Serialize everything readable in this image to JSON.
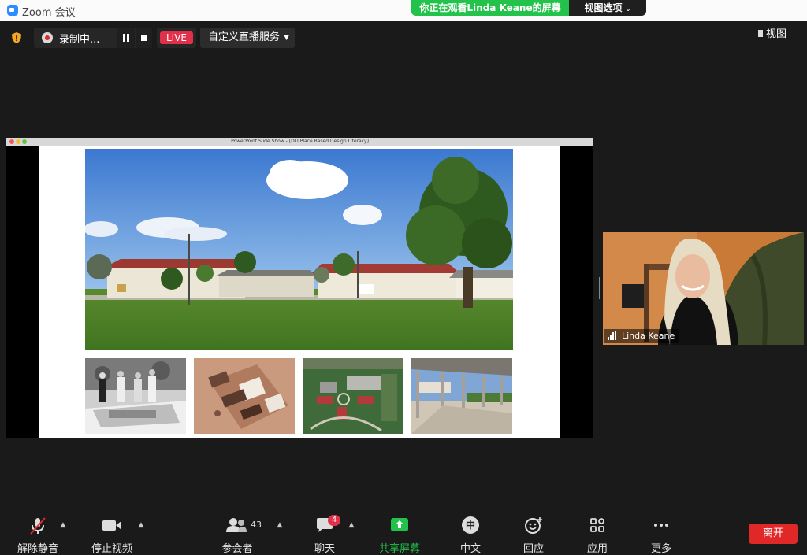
{
  "window": {
    "title": "Zoom 会议"
  },
  "share_banner": {
    "text": "你正在观看Linda Keane的屏幕",
    "view_options": "视图选项"
  },
  "recording": {
    "label": "录制中..."
  },
  "live": {
    "badge": "LIVE",
    "service": "自定义直播服务"
  },
  "view": {
    "label": "视图"
  },
  "shared_window": {
    "title": "PowerPoint Slide Show - [DLI Place Based Design Literacy]"
  },
  "participant": {
    "name": "Linda Keane"
  },
  "toolbar": {
    "unmute": "解除静音",
    "stop_video": "停止视频",
    "participants": "参会者",
    "participants_count": "43",
    "chat": "聊天",
    "chat_badge": "4",
    "share_screen": "共享屏幕",
    "language": "中文",
    "language_icon": "中",
    "reactions": "回应",
    "apps": "应用",
    "more": "更多",
    "leave": "离开"
  },
  "colors": {
    "share_green": "#23c24a",
    "live_red": "#e0304a",
    "leave_red": "#e02828",
    "dark_bg": "#1a1a1a"
  },
  "icons": [
    "zoom-app-icon",
    "shield-icon",
    "record-icon",
    "pause-icon",
    "stop-icon",
    "view-icon",
    "signal-icon",
    "mic-muted-icon",
    "video-camera-icon",
    "participants-icon",
    "chat-icon",
    "share-screen-icon",
    "language-icon",
    "reaction-icon",
    "apps-icon",
    "more-icon",
    "chevron-up-icon"
  ]
}
